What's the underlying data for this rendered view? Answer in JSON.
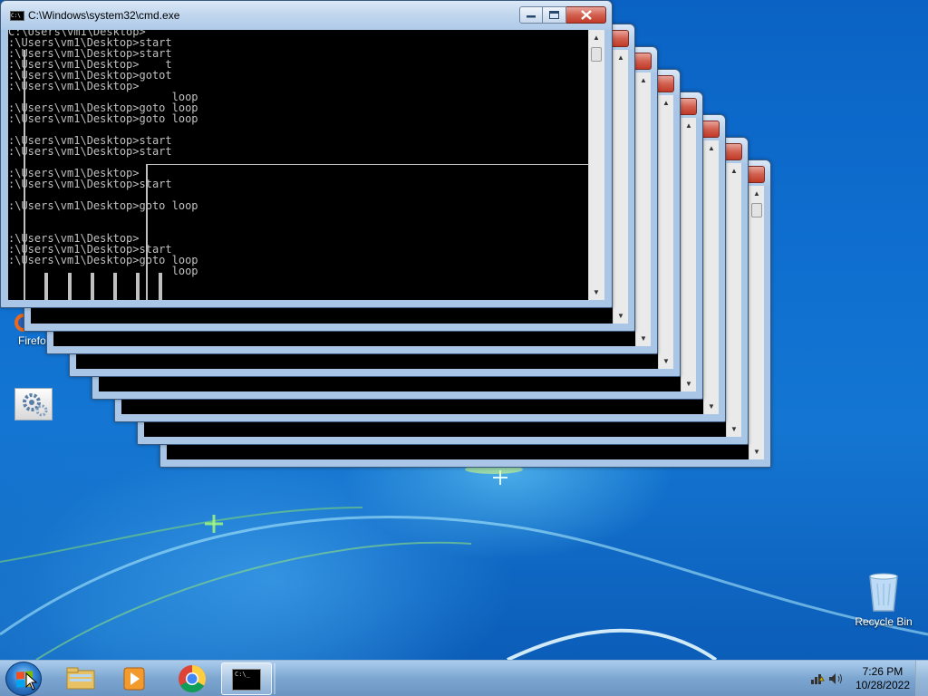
{
  "main_window": {
    "title": "C:\\Windows\\system32\\cmd.exe",
    "app_icon_text": "C:\\",
    "console_lines": [
      "C:\\Users\\vm1\\Desktop>",
      ":\\Users\\vm1\\Desktop>start",
      ":\\Users\\vm1\\Desktop>start",
      ":\\Users\\vm1\\Desktop>    t",
      ":\\Users\\vm1\\Desktop>gotot",
      ":\\Users\\vm1\\Desktop>",
      "                         loop",
      ":\\Users\\vm1\\Desktop>goto loop",
      ":\\Users\\vm1\\Desktop>goto loop",
      "",
      ":\\Users\\vm1\\Desktop>start",
      ":\\Users\\vm1\\Desktop>start",
      "",
      ":\\Users\\vm1\\Desktop>",
      ":\\Users\\vm1\\Desktop>start",
      "",
      ":\\Users\\vm1\\Desktop>goto loop",
      "",
      "",
      ":\\Users\\vm1\\Desktop>",
      ":\\Users\\vm1\\Desktop>start",
      ":\\Users\\vm1\\Desktop>goto loop",
      "                         loop"
    ]
  },
  "cascade_window_count": 7,
  "desktop_icons": {
    "firefox_label": "Firefo",
    "recycle_bin_label": "Recycle Bin"
  },
  "taskbar": {
    "apps": [
      "Windows Explorer",
      "Windows Media Player",
      "Google Chrome",
      "Command Prompt"
    ],
    "active_app": "Command Prompt",
    "cmd_icon_text": "C:\\_",
    "clock_time": "7:26 PM",
    "clock_date": "10/28/2022"
  },
  "colors": {
    "console_bg": "#000000",
    "console_text": "#c0c0c0",
    "window_frame": "#a9c6e6",
    "close_button": "#c23a28"
  }
}
